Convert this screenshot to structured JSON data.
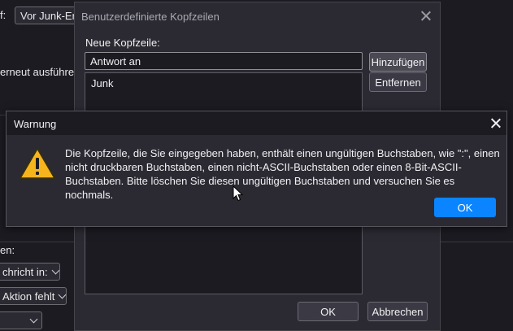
{
  "background": {
    "frag1": "f:",
    "select1": "Vor Junk-Erk",
    "frag2": "erneut ausführen",
    "frag3": "en:",
    "select2": "chricht in:",
    "select3": "Aktion fehlt"
  },
  "headers_dialog": {
    "title": "Benutzerdefinierte Kopfzeilen",
    "new_header_label": "Neue Kopfzeile:",
    "new_header_value": "Antwort an",
    "list_items": [
      "Junk"
    ],
    "add_button": "Hinzufügen",
    "remove_button": "Entfernen",
    "ok_button": "OK",
    "cancel_button": "Abbrechen"
  },
  "warning_dialog": {
    "title": "Warnung",
    "message": "Die Kopfzeile, die Sie eingegeben haben, enthält einen ungültigen Buchstaben, wie \":\", einen nicht druckbaren Buchstaben, einen nicht-ASCII-Buchstaben oder einen 8-Bit-ASCII-Buchstaben. Bitte löschen Sie diesen ungültigen Buchstaben und versuchen Sie es nochmals.",
    "ok_button": "OK",
    "icon": "warning-triangle-icon"
  },
  "colors": {
    "accent": "#0a84ff",
    "warning": "#f6b51d"
  }
}
